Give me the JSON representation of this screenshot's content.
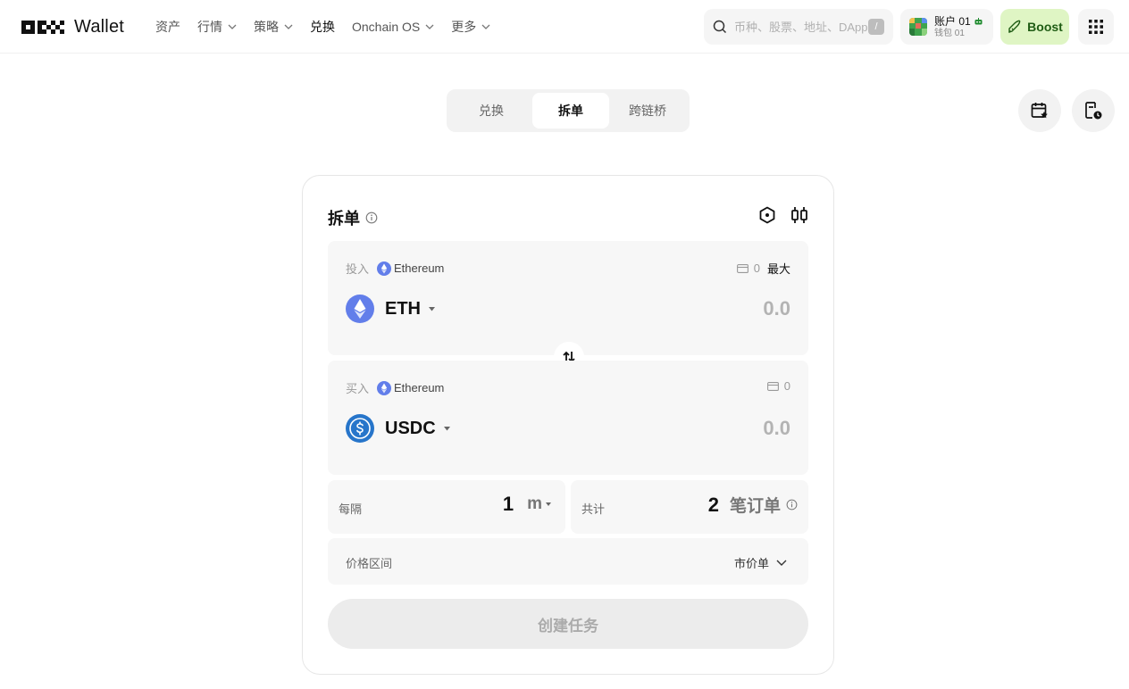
{
  "header": {
    "logo_text": "Wallet",
    "nav": [
      {
        "label": "资产",
        "has_chevron": false
      },
      {
        "label": "行情",
        "has_chevron": true
      },
      {
        "label": "策略",
        "has_chevron": true
      },
      {
        "label": "兑换",
        "has_chevron": false,
        "active": true
      },
      {
        "label": "Onchain OS",
        "has_chevron": true
      },
      {
        "label": "更多",
        "has_chevron": true
      }
    ],
    "search_placeholder": "币种、股票、地址、DApp",
    "search_shortcut": "/",
    "account_name": "账户 01",
    "account_sub": "钱包 01",
    "boost_label": "Boost"
  },
  "tabs": [
    {
      "label": "兑换"
    },
    {
      "label": "拆单",
      "active": true
    },
    {
      "label": "跨链桥"
    }
  ],
  "card": {
    "title": "拆单",
    "from": {
      "label": "投入",
      "chain": "Ethereum",
      "balance": "0",
      "max_label": "最大",
      "token": "ETH",
      "amount_placeholder": "0.0"
    },
    "to": {
      "label": "买入",
      "chain": "Ethereum",
      "balance": "0",
      "token": "USDC",
      "amount_placeholder": "0.0"
    },
    "interval": {
      "label": "每隔",
      "value": "1",
      "unit": "m"
    },
    "total": {
      "label": "共计",
      "value": "2",
      "unit": "笔订单"
    },
    "price_range": {
      "label": "价格区间",
      "type": "市价单"
    },
    "create_button": "创建任务"
  },
  "colors": {
    "eth": "#627eea",
    "usdc": "#2775ca",
    "boost_bg": "#dff5c4",
    "boost_text": "#1f5c14"
  }
}
